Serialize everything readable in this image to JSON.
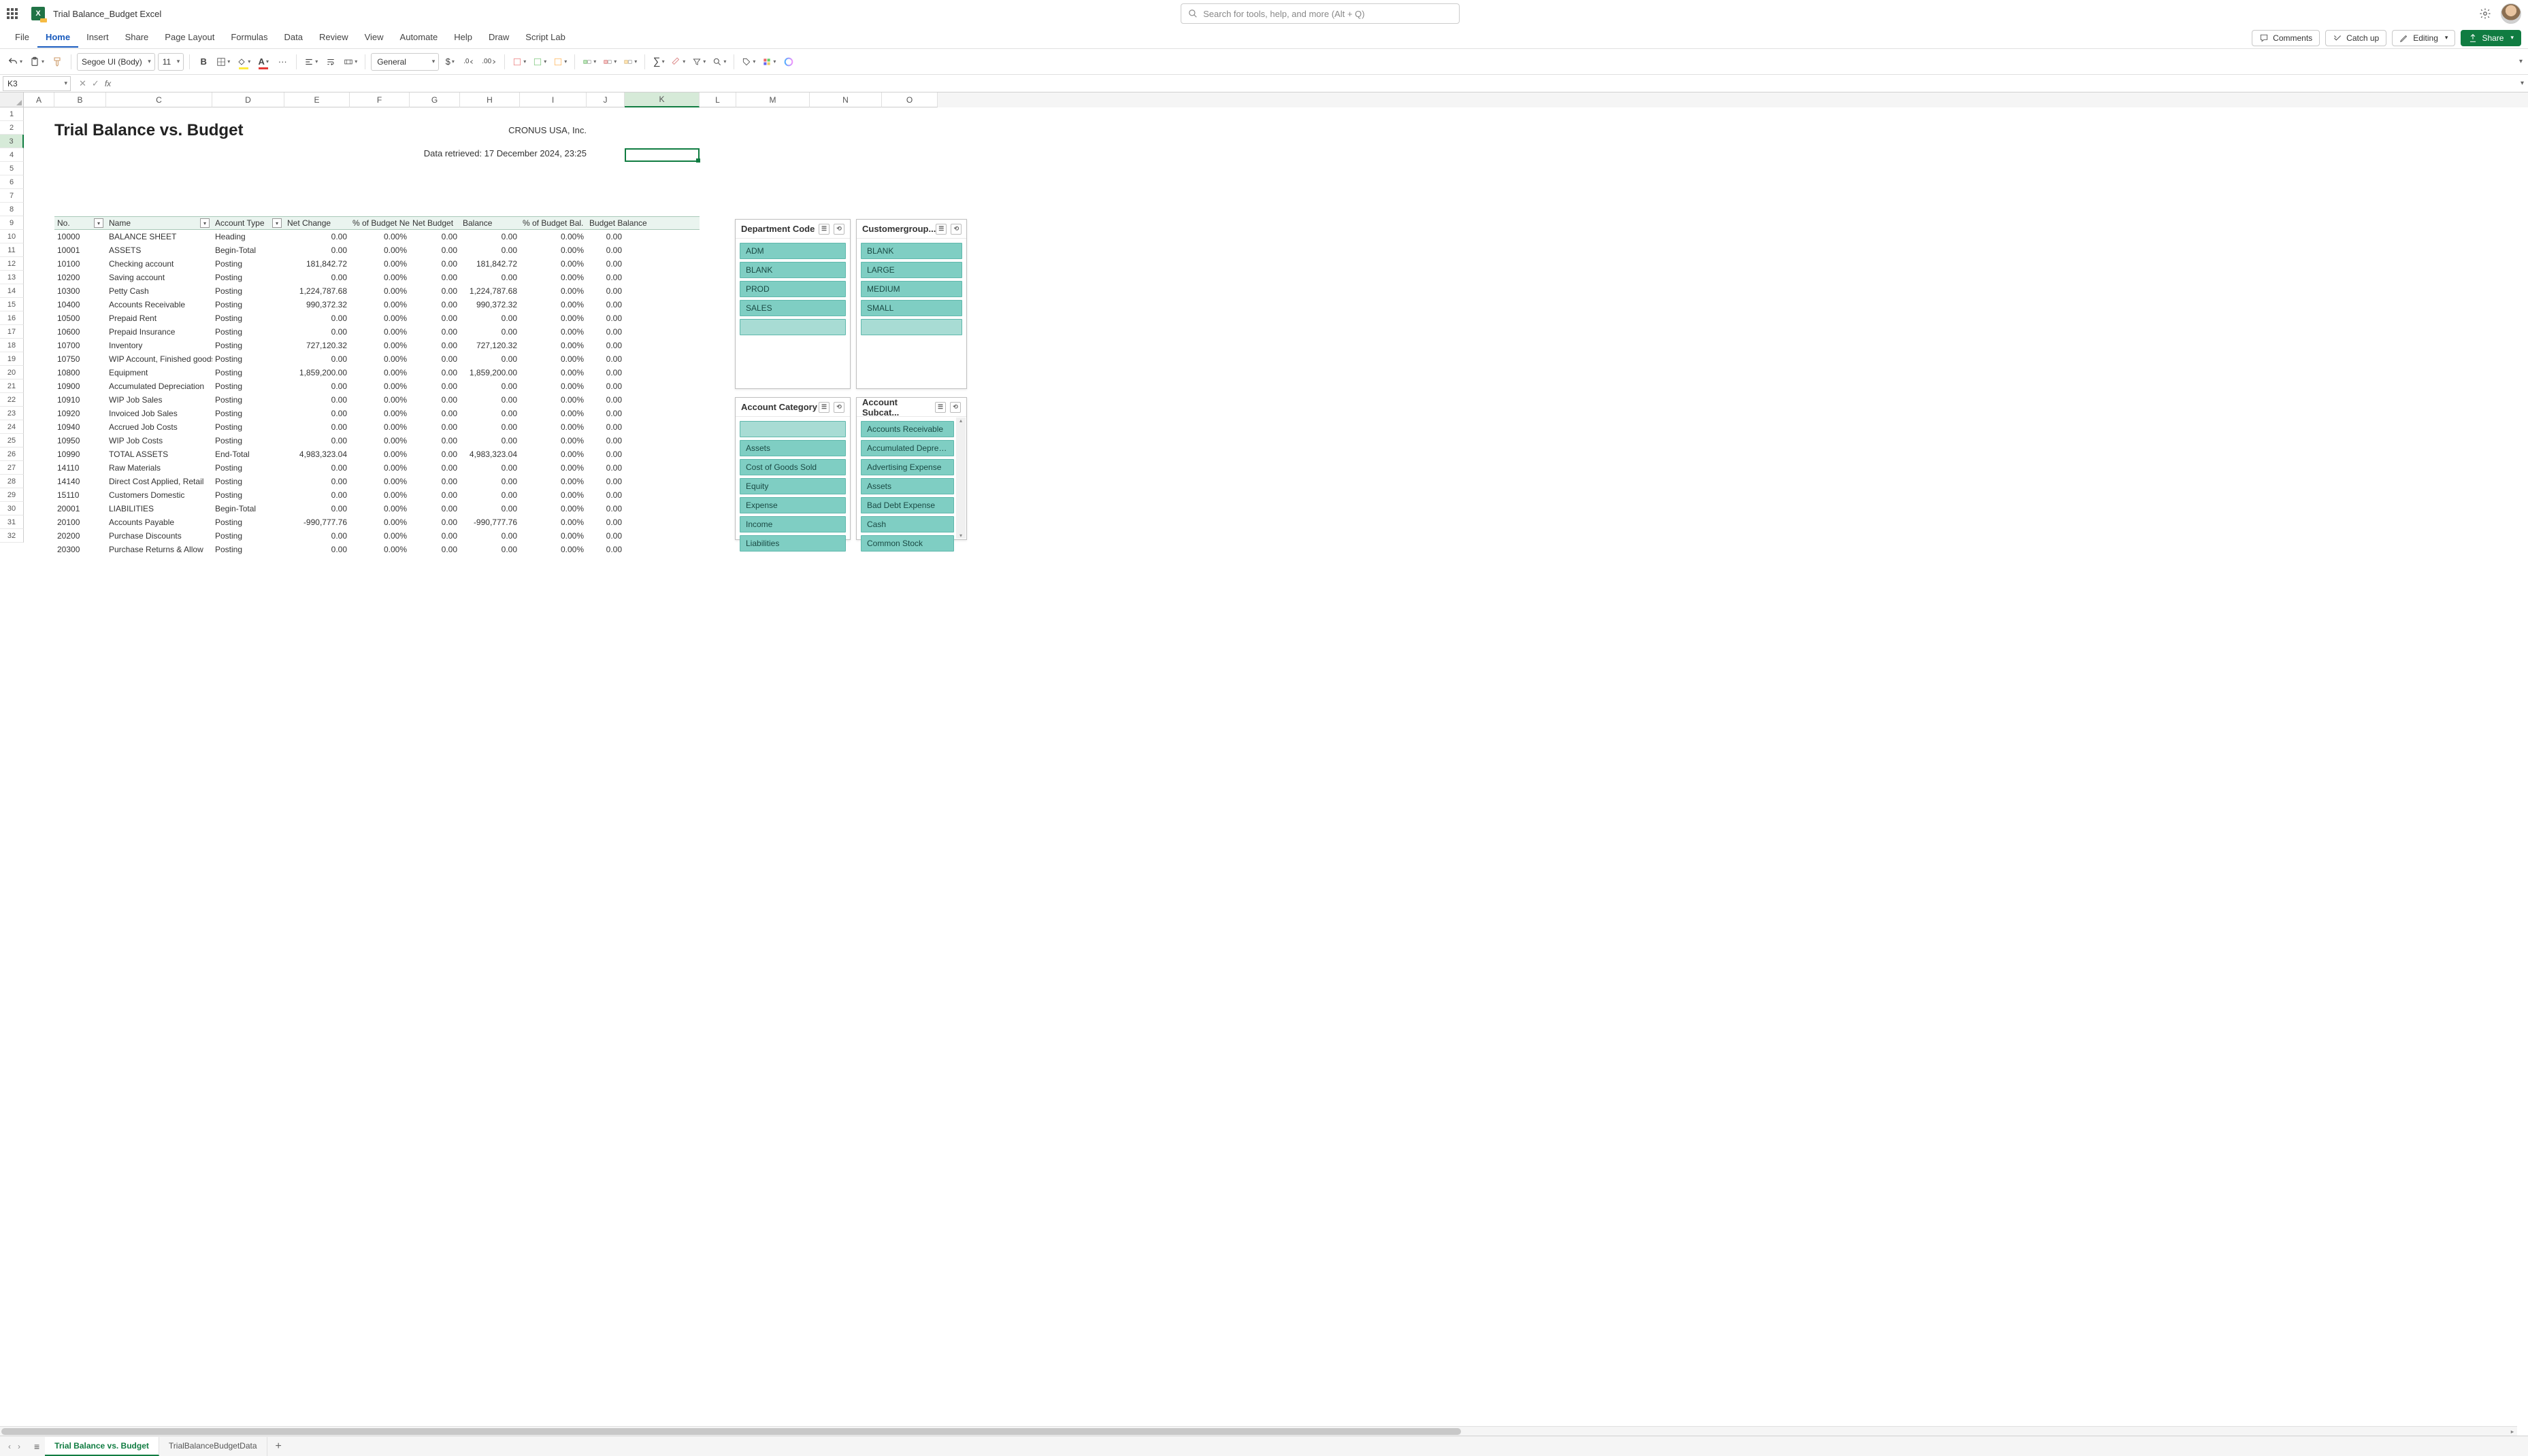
{
  "title_bar": {
    "doc_title": "Trial Balance_Budget Excel"
  },
  "search": {
    "placeholder": "Search for tools, help, and more (Alt + Q)"
  },
  "ribbon": {
    "tabs": [
      "File",
      "Home",
      "Insert",
      "Share",
      "Page Layout",
      "Formulas",
      "Data",
      "Review",
      "View",
      "Automate",
      "Help",
      "Draw",
      "Script Lab"
    ],
    "active": "Home",
    "right": {
      "comments": "Comments",
      "catch_up": "Catch up",
      "editing": "Editing",
      "share": "Share"
    }
  },
  "toolbar": {
    "font": "Segoe UI (Body)",
    "size": "11",
    "number_format": "General"
  },
  "formula_bar": {
    "name_box": "K3",
    "fx": "fx"
  },
  "columns": [
    {
      "l": "A",
      "w": 45
    },
    {
      "l": "B",
      "w": 76
    },
    {
      "l": "C",
      "w": 156
    },
    {
      "l": "D",
      "w": 106
    },
    {
      "l": "E",
      "w": 96
    },
    {
      "l": "F",
      "w": 88
    },
    {
      "l": "G",
      "w": 74
    },
    {
      "l": "H",
      "w": 88
    },
    {
      "l": "I",
      "w": 98
    },
    {
      "l": "J",
      "w": 56
    },
    {
      "l": "K",
      "w": 110
    },
    {
      "l": "L",
      "w": 54
    },
    {
      "l": "M",
      "w": 108
    },
    {
      "l": "N",
      "w": 106
    },
    {
      "l": "O",
      "w": 82
    }
  ],
  "sheet": {
    "title": "Trial Balance vs. Budget",
    "company": "CRONUS USA, Inc.",
    "retrieved": "Data retrieved: 17 December 2024, 23:25"
  },
  "headers": [
    "No.",
    "Name",
    "Account Type",
    "Net Change",
    "% of Budget Net",
    "Net Budget",
    "Balance",
    "% of Budget Bal.",
    "Budget Balance"
  ],
  "rows": [
    {
      "no": "10000",
      "name": "BALANCE SHEET",
      "type": "Heading",
      "net": "0.00",
      "pbn": "0.00%",
      "nb": "0.00",
      "bal": "0.00",
      "pbb": "0.00%",
      "bb": "0.00"
    },
    {
      "no": "10001",
      "name": "ASSETS",
      "type": "Begin-Total",
      "net": "0.00",
      "pbn": "0.00%",
      "nb": "0.00",
      "bal": "0.00",
      "pbb": "0.00%",
      "bb": "0.00"
    },
    {
      "no": "10100",
      "name": "Checking account",
      "type": "Posting",
      "net": "181,842.72",
      "pbn": "0.00%",
      "nb": "0.00",
      "bal": "181,842.72",
      "pbb": "0.00%",
      "bb": "0.00",
      "indent": true
    },
    {
      "no": "10200",
      "name": "Saving account",
      "type": "Posting",
      "net": "0.00",
      "pbn": "0.00%",
      "nb": "0.00",
      "bal": "0.00",
      "pbb": "0.00%",
      "bb": "0.00",
      "indent": true
    },
    {
      "no": "10300",
      "name": "Petty Cash",
      "type": "Posting",
      "net": "1,224,787.68",
      "pbn": "0.00%",
      "nb": "0.00",
      "bal": "1,224,787.68",
      "pbb": "0.00%",
      "bb": "0.00",
      "indent": true
    },
    {
      "no": "10400",
      "name": "Accounts Receivable",
      "type": "Posting",
      "net": "990,372.32",
      "pbn": "0.00%",
      "nb": "0.00",
      "bal": "990,372.32",
      "pbb": "0.00%",
      "bb": "0.00",
      "indent": true
    },
    {
      "no": "10500",
      "name": "Prepaid Rent",
      "type": "Posting",
      "net": "0.00",
      "pbn": "0.00%",
      "nb": "0.00",
      "bal": "0.00",
      "pbb": "0.00%",
      "bb": "0.00",
      "indent": true
    },
    {
      "no": "10600",
      "name": "Prepaid Insurance",
      "type": "Posting",
      "net": "0.00",
      "pbn": "0.00%",
      "nb": "0.00",
      "bal": "0.00",
      "pbb": "0.00%",
      "bb": "0.00",
      "indent": true
    },
    {
      "no": "10700",
      "name": "Inventory",
      "type": "Posting",
      "net": "727,120.32",
      "pbn": "0.00%",
      "nb": "0.00",
      "bal": "727,120.32",
      "pbb": "0.00%",
      "bb": "0.00",
      "indent": true
    },
    {
      "no": "10750",
      "name": "WIP Account, Finished goods",
      "type": "Posting",
      "net": "0.00",
      "pbn": "0.00%",
      "nb": "0.00",
      "bal": "0.00",
      "pbb": "0.00%",
      "bb": "0.00",
      "indent": true
    },
    {
      "no": "10800",
      "name": "Equipment",
      "type": "Posting",
      "net": "1,859,200.00",
      "pbn": "0.00%",
      "nb": "0.00",
      "bal": "1,859,200.00",
      "pbb": "0.00%",
      "bb": "0.00",
      "indent": true
    },
    {
      "no": "10900",
      "name": "Accumulated Depreciation",
      "type": "Posting",
      "net": "0.00",
      "pbn": "0.00%",
      "nb": "0.00",
      "bal": "0.00",
      "pbb": "0.00%",
      "bb": "0.00",
      "indent": true
    },
    {
      "no": "10910",
      "name": "WIP Job Sales",
      "type": "Posting",
      "net": "0.00",
      "pbn": "0.00%",
      "nb": "0.00",
      "bal": "0.00",
      "pbb": "0.00%",
      "bb": "0.00",
      "indent": true
    },
    {
      "no": "10920",
      "name": "Invoiced Job Sales",
      "type": "Posting",
      "net": "0.00",
      "pbn": "0.00%",
      "nb": "0.00",
      "bal": "0.00",
      "pbb": "0.00%",
      "bb": "0.00",
      "indent": true
    },
    {
      "no": "10940",
      "name": "Accrued Job Costs",
      "type": "Posting",
      "net": "0.00",
      "pbn": "0.00%",
      "nb": "0.00",
      "bal": "0.00",
      "pbb": "0.00%",
      "bb": "0.00",
      "indent": true
    },
    {
      "no": "10950",
      "name": "WIP Job Costs",
      "type": "Posting",
      "net": "0.00",
      "pbn": "0.00%",
      "nb": "0.00",
      "bal": "0.00",
      "pbb": "0.00%",
      "bb": "0.00",
      "indent": true
    },
    {
      "no": "10990",
      "name": "TOTAL ASSETS",
      "type": "End-Total",
      "net": "4,983,323.04",
      "pbn": "0.00%",
      "nb": "0.00",
      "bal": "4,983,323.04",
      "pbb": "0.00%",
      "bb": "0.00"
    },
    {
      "no": "14110",
      "name": "Raw Materials",
      "type": "Posting",
      "net": "0.00",
      "pbn": "0.00%",
      "nb": "0.00",
      "bal": "0.00",
      "pbb": "0.00%",
      "bb": "0.00",
      "indent": true
    },
    {
      "no": "14140",
      "name": "Direct Cost Applied, Retail",
      "type": "Posting",
      "net": "0.00",
      "pbn": "0.00%",
      "nb": "0.00",
      "bal": "0.00",
      "pbb": "0.00%",
      "bb": "0.00",
      "indent": true
    },
    {
      "no": "15110",
      "name": "Customers Domestic",
      "type": "Posting",
      "net": "0.00",
      "pbn": "0.00%",
      "nb": "0.00",
      "bal": "0.00",
      "pbb": "0.00%",
      "bb": "0.00",
      "indent": true
    },
    {
      "no": "20001",
      "name": "LIABILITIES",
      "type": "Begin-Total",
      "net": "0.00",
      "pbn": "0.00%",
      "nb": "0.00",
      "bal": "0.00",
      "pbb": "0.00%",
      "bb": "0.00"
    },
    {
      "no": "20100",
      "name": "Accounts Payable",
      "type": "Posting",
      "net": "-990,777.76",
      "pbn": "0.00%",
      "nb": "0.00",
      "bal": "-990,777.76",
      "pbb": "0.00%",
      "bb": "0.00",
      "indent": true
    },
    {
      "no": "20200",
      "name": "Purchase Discounts",
      "type": "Posting",
      "net": "0.00",
      "pbn": "0.00%",
      "nb": "0.00",
      "bal": "0.00",
      "pbb": "0.00%",
      "bb": "0.00",
      "indent": true
    },
    {
      "no": "20300",
      "name": "Purchase Returns & Allow",
      "type": "Posting",
      "net": "0.00",
      "pbn": "0.00%",
      "nb": "0.00",
      "bal": "0.00",
      "pbb": "0.00%",
      "bb": "0.00",
      "indent": true
    }
  ],
  "slicers": {
    "dept": {
      "title": "Department Code",
      "items": [
        "ADM",
        "BLANK",
        "PROD",
        "SALES",
        ""
      ]
    },
    "cust": {
      "title": "Customergroup...",
      "items": [
        "BLANK",
        "LARGE",
        "MEDIUM",
        "SMALL",
        ""
      ]
    },
    "acat": {
      "title": "Account Category",
      "items": [
        "",
        "Assets",
        "Cost of Goods Sold",
        "Equity",
        "Expense",
        "Income",
        "Liabilities"
      ]
    },
    "asub": {
      "title": "Account Subcat...",
      "items": [
        "Accounts Receivable",
        "Accumulated Depreci...",
        "Advertising Expense",
        "Assets",
        "Bad Debt Expense",
        "Cash",
        "Common Stock"
      ]
    }
  },
  "sheets": {
    "tabs": [
      "Trial Balance vs. Budget",
      "TrialBalanceBudgetData"
    ],
    "active": "Trial Balance vs. Budget"
  }
}
